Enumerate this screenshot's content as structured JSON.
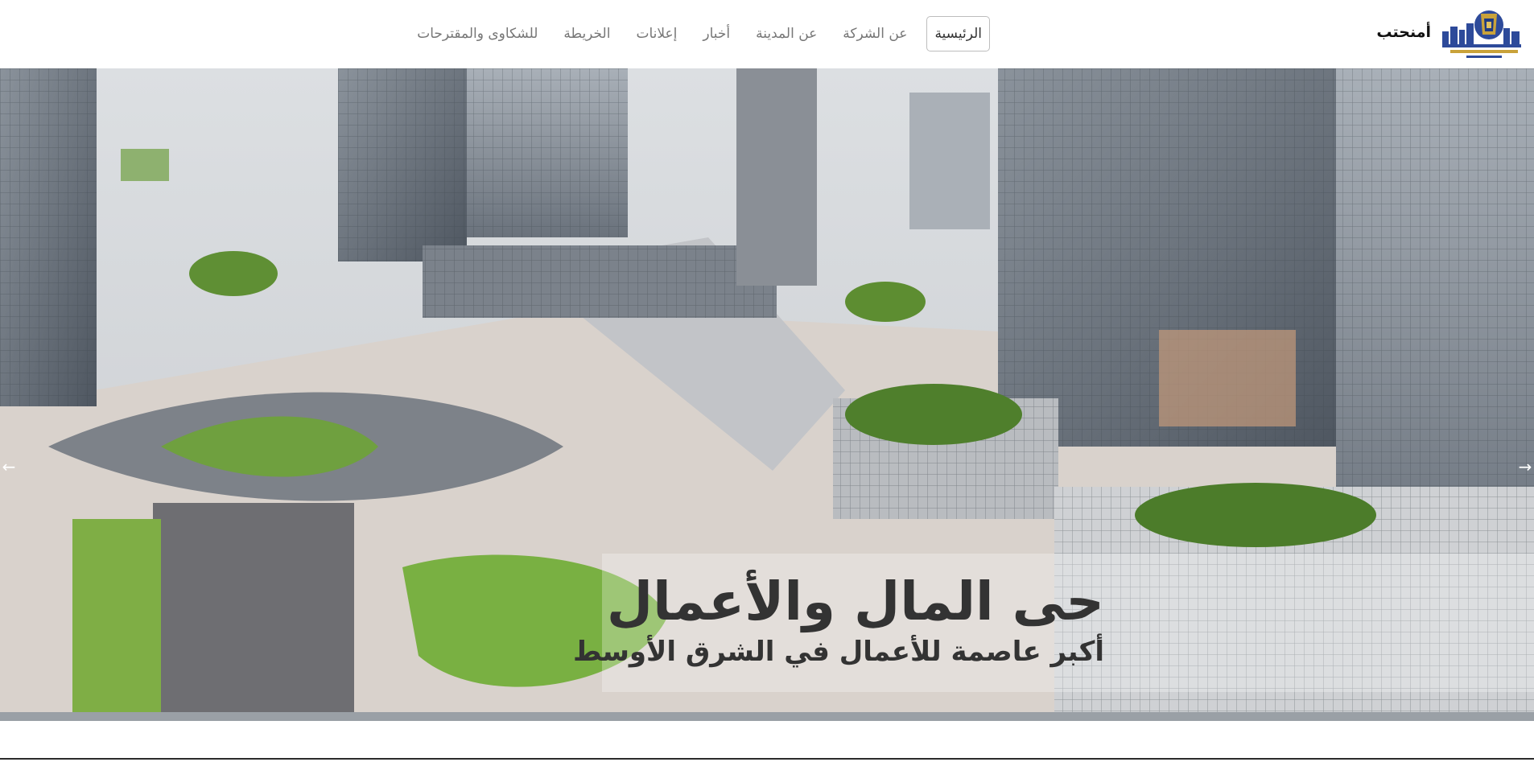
{
  "brand": {
    "name": "أمنحتب",
    "logo_icon": "company-logo-icon"
  },
  "nav": {
    "items": [
      {
        "label": "الرئيسية",
        "active": true
      },
      {
        "label": "عن الشركة",
        "active": false
      },
      {
        "label": "عن المدينة",
        "active": false
      },
      {
        "label": "أخبار",
        "active": false
      },
      {
        "label": "إعلانات",
        "active": false
      },
      {
        "label": "الخريطة",
        "active": false
      },
      {
        "label": "للشكاوى والمقترحات",
        "active": false
      }
    ]
  },
  "hero": {
    "title": "حى المال والأعمال",
    "subtitle": "أكبر عاصمة للأعمال في الشرق الأوسط",
    "prev_icon": "arrow-left-icon",
    "next_icon": "arrow-right-icon"
  },
  "colors": {
    "nav_text": "#777777",
    "nav_active_text": "#333333",
    "caption_text": "#333333",
    "caption_band": "rgba(255,255,255,0.28)"
  }
}
